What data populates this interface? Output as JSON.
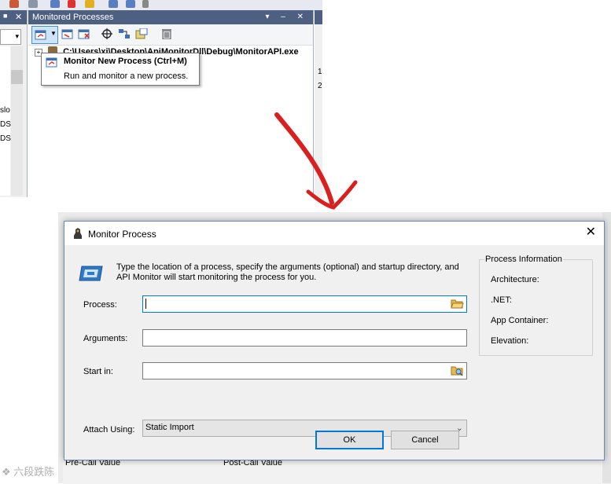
{
  "ide": {
    "monitored_pane_title": "Monitored Processes",
    "pane_controls": "▾ – ✕",
    "left_pane_controls": "✕",
    "left_items": [
      "slo",
      "DS",
      "DS"
    ],
    "process_path": "C:\\Users\\xi\\Desktop\\ApiMonitorDll\\Debug\\MonitorAPI.exe",
    "side_numbers": [
      "1",
      "2"
    ],
    "status_pre": "Pre-Call Value",
    "status_post": "Post-Call Value"
  },
  "tooltip": {
    "title": "Monitor New Process (Ctrl+M)",
    "description": "Run and monitor a new process."
  },
  "dialog": {
    "title": "Monitor Process",
    "close": "✕",
    "info_line1": "Type the location of a process, specify the arguments (optional) and startup directory, and",
    "info_line2": "API Monitor will start monitoring the process for you.",
    "process_label": "Process:",
    "process_value": "",
    "arguments_label": "Arguments:",
    "arguments_value": "",
    "start_in_label": "Start in:",
    "start_in_value": "",
    "attach_label": "Attach Using:",
    "attach_value": "Static Import",
    "process_info": {
      "title": "Process Information",
      "architecture": "Architecture:",
      "dotnet": ".NET:",
      "app_container": "App Container:",
      "elevation": "Elevation:"
    },
    "ok_label": "OK",
    "cancel_label": "Cancel"
  },
  "colors": {
    "pane_header": "#4d6082",
    "arrow_red": "#d9201f",
    "ok_border": "#0078d7"
  },
  "watermark": "六段跌陈"
}
